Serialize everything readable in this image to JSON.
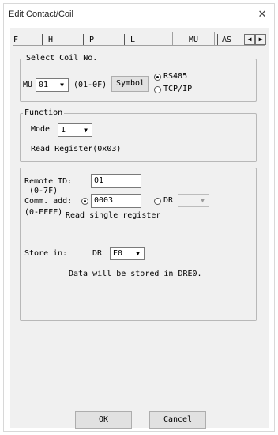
{
  "window": {
    "title": "Edit Contact/Coil",
    "close_glyph": "✕"
  },
  "tabs": [
    {
      "label": "F"
    },
    {
      "label": "H"
    },
    {
      "label": "P"
    },
    {
      "label": "L"
    },
    {
      "label": "MU",
      "active": true
    },
    {
      "label": "AS"
    }
  ],
  "tab_scroll": {
    "left": "◀",
    "right": "▶"
  },
  "select_coil": {
    "legend": "Select Coil No.",
    "prefix": "MU",
    "coil_value": "01",
    "range_hint": "(01-0F)",
    "symbol_button": "Symbol",
    "protocol_options": [
      {
        "label": "RS485",
        "selected": true
      },
      {
        "label": "TCP/IP",
        "selected": false
      }
    ]
  },
  "function": {
    "legend": "Function",
    "mode_label": "Mode",
    "mode_value": "1",
    "description": "Read Register(0x03)"
  },
  "params": {
    "remote_id_label": "Remote ID:",
    "remote_id_range": "(0-7F)",
    "remote_id_value": "01",
    "comm_add_label": "Comm. add:",
    "comm_add_range": "(0-FFFF)",
    "comm_add_value": "0003",
    "dr_option_label": "DR",
    "operation_text": "Read single register",
    "store_label": "Store in:",
    "store_type": "DR",
    "store_value": "E0",
    "store_note": "Data will be stored in DRE0."
  },
  "buttons": {
    "ok": "OK",
    "cancel": "Cancel"
  }
}
